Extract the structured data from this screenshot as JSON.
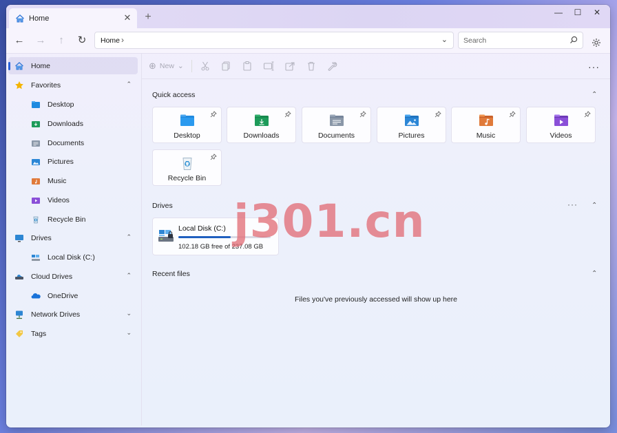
{
  "window": {
    "tab_title": "Home",
    "tab_close": "✕",
    "new_tab": "+",
    "controls": {
      "minimize": "—",
      "maximize": "☐",
      "close": "✕"
    }
  },
  "nav": {
    "back": "←",
    "forward": "→",
    "up": "↑",
    "refresh": "↻",
    "breadcrumb": "Home",
    "breadcrumb_sep": "›",
    "dropdown": "⌄",
    "search_placeholder": "Search"
  },
  "sidebar": {
    "items": [
      {
        "label": "Home",
        "icon": "home-icon",
        "level": 0,
        "selected": true
      },
      {
        "label": "Favorites",
        "icon": "star-icon",
        "level": 0,
        "chevron": "⌃"
      },
      {
        "label": "Desktop",
        "icon": "folder-desktop-icon",
        "level": 1
      },
      {
        "label": "Downloads",
        "icon": "folder-downloads-icon",
        "level": 1
      },
      {
        "label": "Documents",
        "icon": "folder-documents-icon",
        "level": 1
      },
      {
        "label": "Pictures",
        "icon": "folder-pictures-icon",
        "level": 1
      },
      {
        "label": "Music",
        "icon": "folder-music-icon",
        "level": 1
      },
      {
        "label": "Videos",
        "icon": "folder-videos-icon",
        "level": 1
      },
      {
        "label": "Recycle Bin",
        "icon": "recycle-bin-icon",
        "level": 1
      },
      {
        "label": "Drives",
        "icon": "monitor-icon",
        "level": 0,
        "chevron": "⌃"
      },
      {
        "label": "Local Disk (C:)",
        "icon": "local-disk-icon",
        "level": 1
      },
      {
        "label": "Cloud Drives",
        "icon": "cloud-drive-icon",
        "level": 0,
        "chevron": "⌃"
      },
      {
        "label": "OneDrive",
        "icon": "onedrive-icon",
        "level": 1
      },
      {
        "label": "Network Drives",
        "icon": "network-icon",
        "level": 0,
        "chevron": "⌄"
      },
      {
        "label": "Tags",
        "icon": "tag-icon",
        "level": 0,
        "chevron": "⌄"
      }
    ]
  },
  "toolbar": {
    "new_label": "New",
    "new_icon": "⊕",
    "chevron": "⌄",
    "more": "···"
  },
  "quick_access": {
    "title": "Quick access",
    "chevron": "⌃",
    "items": [
      {
        "label": "Desktop",
        "icon": "folder-desktop-icon"
      },
      {
        "label": "Downloads",
        "icon": "folder-downloads-icon"
      },
      {
        "label": "Documents",
        "icon": "folder-documents-icon"
      },
      {
        "label": "Pictures",
        "icon": "folder-pictures-icon"
      },
      {
        "label": "Music",
        "icon": "folder-music-icon"
      },
      {
        "label": "Videos",
        "icon": "folder-videos-icon"
      },
      {
        "label": "Recycle Bin",
        "icon": "recycle-bin-icon"
      }
    ]
  },
  "drives": {
    "title": "Drives",
    "more": "···",
    "chevron": "⌃",
    "items": [
      {
        "name": "Local Disk (C:)",
        "free_text": "102.18 GB free of 237.08 GB",
        "used_fraction": 0.569
      }
    ]
  },
  "recent": {
    "title": "Recent files",
    "chevron": "⌃",
    "empty_message": "Files you've previously accessed will show up here"
  },
  "watermark": "j301.cn",
  "colors": {
    "accent": "#2962d9",
    "folder_blue": "#1f8ae0",
    "folder_green": "#1d9b5a",
    "folder_gray": "#8a97a8",
    "folder_pics": "#2b86d6",
    "folder_music": "#e07a3a",
    "folder_videos": "#8a4fd8"
  }
}
